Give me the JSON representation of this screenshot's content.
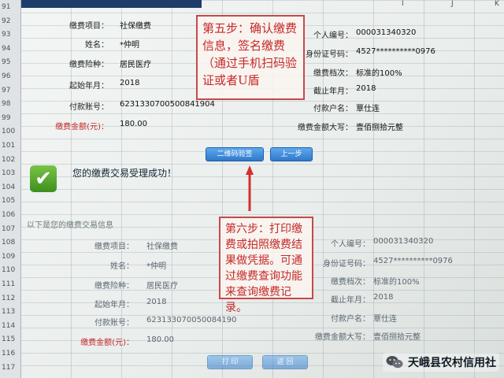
{
  "columns": [
    "I",
    "J",
    "K"
  ],
  "rows": [
    "91",
    "92",
    "93",
    "94",
    "95",
    "96",
    "97",
    "98",
    "99",
    "100",
    "101",
    "102",
    "103",
    "104",
    "105",
    "106",
    "107",
    "108",
    "109",
    "110",
    "111",
    "112",
    "113",
    "114",
    "115",
    "116",
    "117"
  ],
  "top_form": {
    "fields_left": [
      {
        "label": "缴费项目：",
        "value": "社保缴费"
      },
      {
        "label": "姓名：",
        "value": "*仲明"
      },
      {
        "label": "缴费险种：",
        "value": "居民医疗"
      },
      {
        "label": "起始年月：",
        "value": "2018"
      },
      {
        "label": "付款账号：",
        "value": "6231330700500841904"
      }
    ],
    "amount_label": "缴费金额(元)：",
    "amount_value": "180.00",
    "fields_right": [
      {
        "label": "个人编号：",
        "value": "000031340320"
      },
      {
        "label": "身份证号码：",
        "value": "4527**********0976"
      },
      {
        "label": "缴费档次：",
        "value": "标准的100%"
      },
      {
        "label": "截止年月：",
        "value": "2018"
      },
      {
        "label": "付款户名：",
        "value": "覃仕连"
      },
      {
        "label": "缴费金额大写：",
        "value": "壹佰捌拾元整"
      }
    ]
  },
  "note_step5": "第五步：确认缴费信息，签名缴费（通过手机扫码验证或者U盾",
  "buttons": {
    "qr_verify": "二维码验签",
    "prev": "上一步"
  },
  "success_text": "您的缴费交易受理成功！",
  "section_header": "以下是您的缴费交易信息",
  "bottom_form": {
    "fields_left": [
      {
        "label": "缴费项目：",
        "value": "社保缴费"
      },
      {
        "label": "姓名：",
        "value": "*仲明"
      },
      {
        "label": "缴费险种：",
        "value": "居民医疗"
      },
      {
        "label": "起始年月：",
        "value": "2018"
      },
      {
        "label": "付款账号：",
        "value": "623133070050084190"
      }
    ],
    "amount_label": "缴费金额(元)：",
    "amount_value": "180.00",
    "fields_right": [
      {
        "label": "个人编号：",
        "value": "000031340320"
      },
      {
        "label": "身份证号码：",
        "value": "4527**********0976"
      },
      {
        "label": "缴费档次：",
        "value": "标准的100%"
      },
      {
        "label": "截止年月：",
        "value": "2018"
      },
      {
        "label": "付款户名：",
        "value": "覃仕连"
      },
      {
        "label": "缴费金额大写：",
        "value": "壹佰捌拾元整"
      }
    ]
  },
  "note_step6": "第六步：打印缴费或拍照缴费结果做凭据。可通过缴费查询功能来查询缴费记录。",
  "bottom_buttons": {
    "print": "打 印",
    "back": "返 回"
  },
  "watermark": "天峨县农村信用社",
  "colors": {
    "note_red": "#c62828",
    "button_blue": "#2f78c9",
    "success_green": "#4fa52a"
  }
}
